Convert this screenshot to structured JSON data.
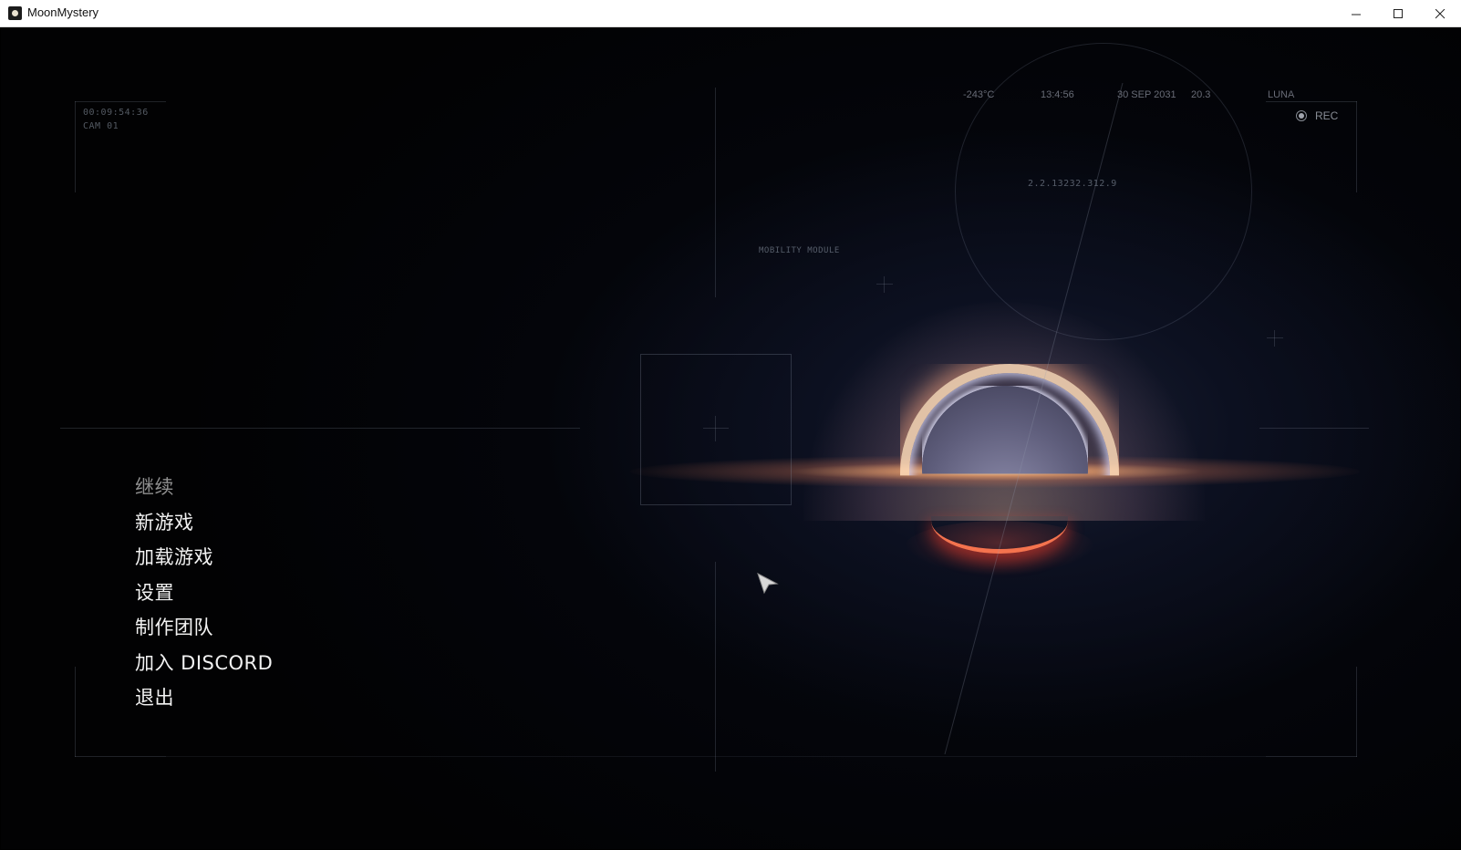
{
  "window": {
    "title": "MoonMystery",
    "controls": {
      "minimize": "—",
      "maximize": "☐",
      "close": "✕"
    }
  },
  "hud": {
    "timecode": "00:09:54:36",
    "camera": "CAM 01",
    "temperature": "-243°C",
    "time": "13:4:56",
    "date": "30 SEP 2031",
    "value": "20.3",
    "location": "LUNA",
    "rec_label": "REC",
    "coordinates": "2.2.13232.312.9",
    "module": "MOBILITY MODULE"
  },
  "menu": {
    "items": [
      {
        "label": "继续",
        "enabled": false
      },
      {
        "label": "新游戏",
        "enabled": true
      },
      {
        "label": "加载游戏",
        "enabled": true
      },
      {
        "label": "设置",
        "enabled": true
      },
      {
        "label": "制作团队",
        "enabled": true
      },
      {
        "label": "加入 DISCORD",
        "enabled": true
      },
      {
        "label": "退出",
        "enabled": true
      }
    ]
  },
  "icons": {
    "app": "moon-icon",
    "rec": "record-dot-icon",
    "cursor": "arrow-cursor-icon"
  },
  "colors": {
    "menu_text": "#f2f2f2",
    "menu_disabled": "#8f8f8f",
    "accretion": "#ffdcb9",
    "lower_arc": "#ff7850"
  }
}
